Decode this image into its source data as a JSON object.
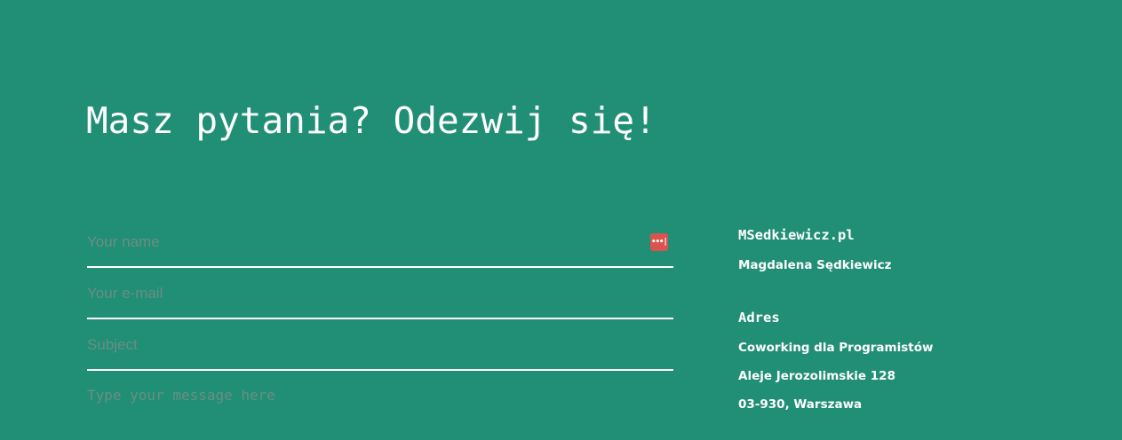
{
  "contact": {
    "title": "Masz pytania? Odezwij się!",
    "form": {
      "name_placeholder": "Your name",
      "email_placeholder": "Your e-mail",
      "subject_placeholder": "Subject",
      "message_placeholder": "Type your message here",
      "name_value": "",
      "email_value": "",
      "subject_value": "",
      "message_value": "",
      "password_manager_icon": "password-manager-icon",
      "password_manager_glyph": "•••|",
      "accent_color": "#d9534f"
    },
    "info": {
      "site": "MSedkiewicz.pl",
      "owner": "Magdalena Sędkiewicz",
      "address_heading": "Adres",
      "address_line1": "Coworking dla Programistów",
      "address_line2": "Aleje Jerozolimskie 128",
      "address_line3": "03-930, Warszawa"
    },
    "colors": {
      "background": "#218e76",
      "text": "#ffffff",
      "placeholder": "#6a8f83"
    }
  }
}
